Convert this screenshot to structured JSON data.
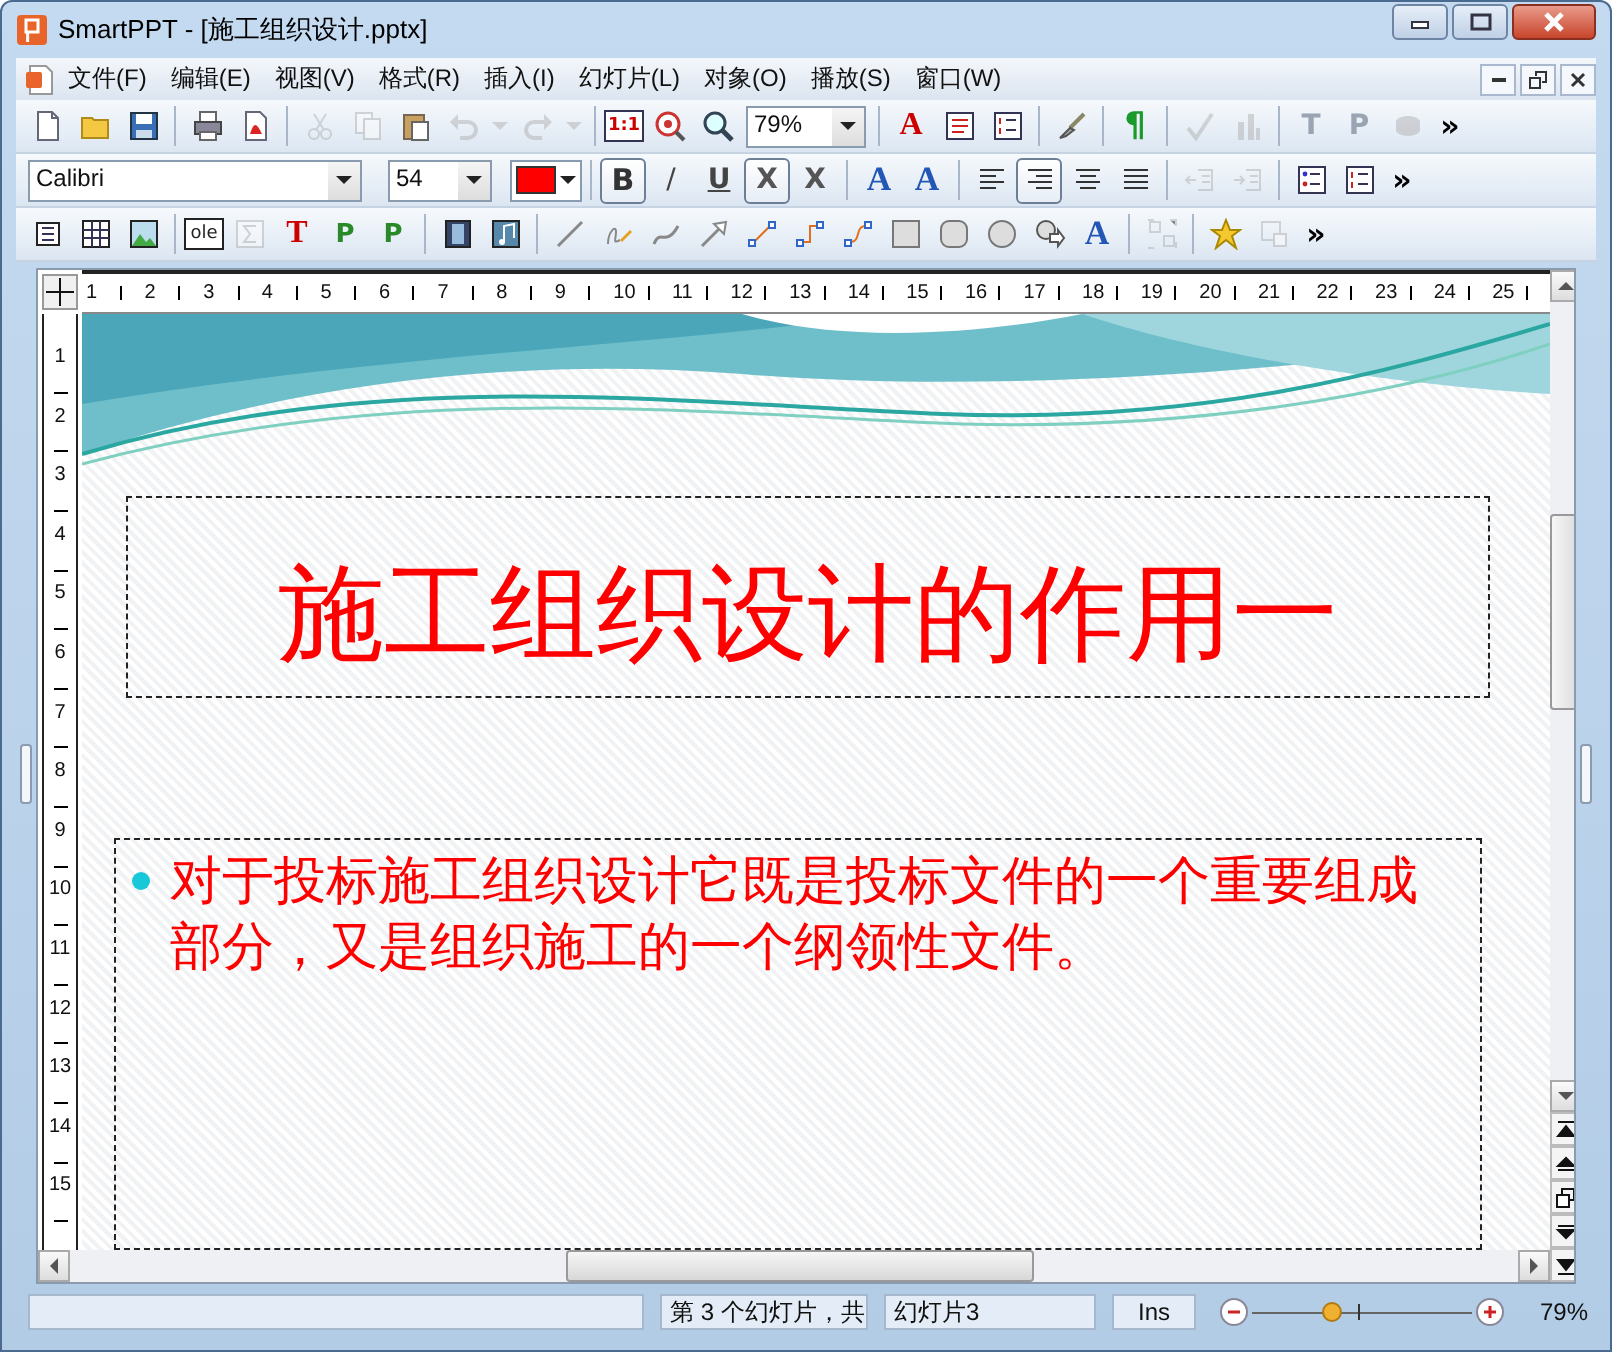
{
  "window": {
    "title": "SmartPPT - [施工组织设计.pptx]"
  },
  "menu": [
    {
      "label": "文件(F)"
    },
    {
      "label": "编辑(E)"
    },
    {
      "label": "视图(V)"
    },
    {
      "label": "格式(R)"
    },
    {
      "label": "插入(I)"
    },
    {
      "label": "幻灯片(L)"
    },
    {
      "label": "对象(O)"
    },
    {
      "label": "播放(S)"
    },
    {
      "label": "窗口(W)"
    }
  ],
  "toolbars": [
    {
      "items": [
        {
          "kind": "new-file",
          "disabled": false
        },
        {
          "kind": "folder",
          "disabled": false
        },
        {
          "kind": "save",
          "disabled": false
        },
        {
          "kind": "separator"
        },
        {
          "kind": "print",
          "disabled": false
        },
        {
          "kind": "pdf",
          "disabled": false
        },
        {
          "kind": "separator"
        },
        {
          "kind": "scissors",
          "disabled": true
        },
        {
          "kind": "copy",
          "disabled": true
        },
        {
          "kind": "paste",
          "disabled": false
        },
        {
          "kind": "undo",
          "disabled": true
        },
        {
          "kind": "caret",
          "disabled": true
        },
        {
          "kind": "redo",
          "disabled": true
        },
        {
          "kind": "caret",
          "disabled": true
        },
        {
          "kind": "separator"
        },
        {
          "kind": "actual-size",
          "text": "1:1",
          "disabled": false
        },
        {
          "kind": "zoom-target",
          "disabled": false
        },
        {
          "kind": "search",
          "disabled": false
        },
        {
          "kind": "zoom-combo",
          "value": "79%"
        },
        {
          "kind": "separator"
        },
        {
          "kind": "font-frame",
          "text": "A",
          "disabled": false
        },
        {
          "kind": "paragraph",
          "disabled": false
        },
        {
          "kind": "numbered-list",
          "disabled": false
        },
        {
          "kind": "separator"
        },
        {
          "kind": "brush",
          "disabled": false
        },
        {
          "kind": "separator"
        },
        {
          "kind": "pilcrow",
          "text": "¶",
          "disabled": false
        },
        {
          "kind": "separator"
        },
        {
          "kind": "spellcheck",
          "disabled": true
        },
        {
          "kind": "bar-chart",
          "disabled": true
        },
        {
          "kind": "separator"
        },
        {
          "kind": "letter-frame",
          "text": "T",
          "disabled": true
        },
        {
          "kind": "letter-frame",
          "text": "P",
          "disabled": true
        },
        {
          "kind": "stack",
          "disabled": true
        },
        {
          "kind": "more",
          "text": "»"
        }
      ]
    },
    {
      "items": [
        {
          "kind": "font-combo",
          "value": "Calibri"
        },
        {
          "kind": "size-combo",
          "value": "54"
        },
        {
          "kind": "color-picker",
          "color": "#ff0000"
        },
        {
          "kind": "separator"
        },
        {
          "kind": "bold",
          "text": "B",
          "pressed": true,
          "disabled": false
        },
        {
          "kind": "italic",
          "text": "/",
          "pressed": false,
          "disabled": false
        },
        {
          "kind": "underline",
          "text": "U",
          "pressed": false,
          "disabled": false
        },
        {
          "kind": "strikethrough",
          "text": "X",
          "pressed": true,
          "disabled": false
        },
        {
          "kind": "superscript",
          "text": "X",
          "pressed": false,
          "disabled": false
        },
        {
          "kind": "separator"
        },
        {
          "kind": "grow-font",
          "text": "A",
          "pressed": false,
          "disabled": false
        },
        {
          "kind": "shrink-font",
          "text": "A",
          "pressed": false,
          "disabled": false
        },
        {
          "kind": "separator"
        },
        {
          "kind": "align-left",
          "pressed": false,
          "disabled": false
        },
        {
          "kind": "align-right",
          "pressed": true,
          "disabled": false
        },
        {
          "kind": "align-center",
          "pressed": false,
          "disabled": false
        },
        {
          "kind": "justify",
          "pressed": false,
          "disabled": false
        },
        {
          "kind": "separator"
        },
        {
          "kind": "outdent",
          "pressed": false,
          "disabled": true
        },
        {
          "kind": "indent",
          "pressed": false,
          "disabled": true
        },
        {
          "kind": "separator"
        },
        {
          "kind": "bullet-list",
          "pressed": false,
          "disabled": false
        },
        {
          "kind": "numbered-list",
          "pressed": false,
          "disabled": false
        },
        {
          "kind": "more",
          "text": "»"
        }
      ]
    },
    {
      "items": [
        {
          "kind": "text-box",
          "disabled": false
        },
        {
          "kind": "table",
          "disabled": false
        },
        {
          "kind": "image",
          "disabled": false
        },
        {
          "kind": "separator"
        },
        {
          "kind": "ole-object",
          "text": "ole",
          "disabled": false
        },
        {
          "kind": "formula",
          "disabled": true
        },
        {
          "kind": "text-frame",
          "text": "T",
          "disabled": false
        },
        {
          "kind": "placeholder",
          "text": "P",
          "disabled": false
        },
        {
          "kind": "placeholder",
          "text": "P",
          "disabled": false
        },
        {
          "kind": "separator"
        },
        {
          "kind": "film",
          "disabled": false
        },
        {
          "kind": "music-note",
          "disabled": false
        },
        {
          "kind": "separator"
        },
        {
          "kind": "line",
          "disabled": false
        },
        {
          "kind": "pencil",
          "disabled": false
        },
        {
          "kind": "curve",
          "disabled": false
        },
        {
          "kind": "arrow",
          "disabled": false
        },
        {
          "kind": "connector",
          "disabled": false
        },
        {
          "kind": "elbow-connector",
          "disabled": false
        },
        {
          "kind": "curved-connector",
          "disabled": false
        },
        {
          "kind": "rectangle",
          "disabled": false
        },
        {
          "kind": "rounded-rectangle",
          "disabled": false
        },
        {
          "kind": "ellipse",
          "disabled": false
        },
        {
          "kind": "shapes",
          "disabled": false
        },
        {
          "kind": "wordart",
          "text": "A",
          "disabled": false
        },
        {
          "kind": "separator"
        },
        {
          "kind": "group",
          "disabled": true
        },
        {
          "kind": "separator"
        },
        {
          "kind": "star",
          "disabled": false
        },
        {
          "kind": "ungroup",
          "disabled": true
        },
        {
          "kind": "more",
          "text": "»"
        }
      ]
    }
  ],
  "ruler": {
    "horizontal": [
      "1",
      "2",
      "3",
      "4",
      "5",
      "6",
      "7",
      "8",
      "9",
      "10",
      "11",
      "12",
      "13",
      "14",
      "15",
      "16",
      "17",
      "18",
      "19",
      "20",
      "21",
      "22",
      "23",
      "24",
      "25"
    ],
    "vertical": [
      "1",
      "2",
      "3",
      "4",
      "5",
      "6",
      "7",
      "8",
      "9",
      "10",
      "11",
      "12",
      "13",
      "14",
      "15"
    ]
  },
  "slide": {
    "title": "施工组织设计的作用一",
    "bullets": [
      {
        "text": "对于投标施工组织设计它既是投标文件的一个重要组成部分，又是组织施工的一个纲领性文件。"
      }
    ]
  },
  "status_bar": {
    "message": "第 3 个幻灯片，共",
    "slide_name": "幻灯片3",
    "mode": "Ins",
    "zoom": {
      "level": 0.36,
      "reading": "79%"
    }
  }
}
